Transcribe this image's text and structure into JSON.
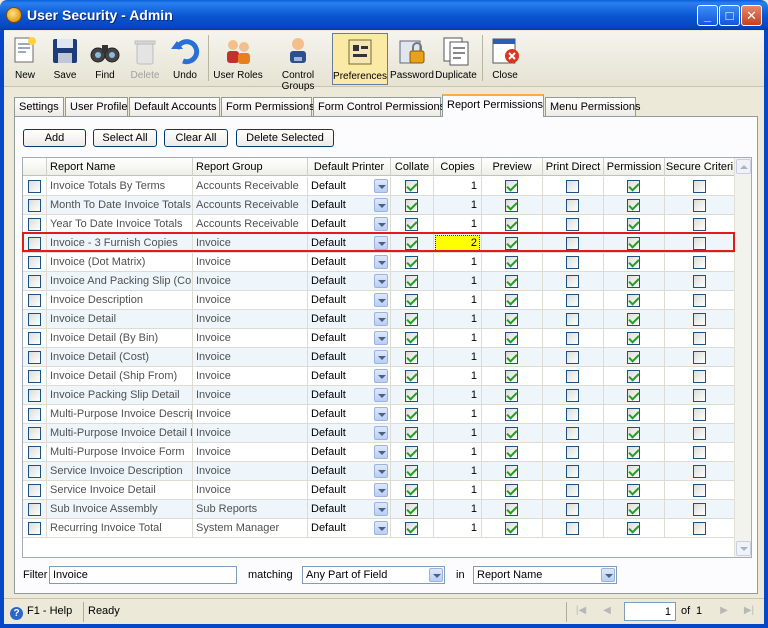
{
  "window": {
    "title": "User Security - Admin"
  },
  "toolbar": [
    {
      "label": "New",
      "icon": "new-document-icon",
      "state": "normal"
    },
    {
      "label": "Save",
      "icon": "floppy-disk-icon",
      "state": "normal"
    },
    {
      "label": "Find",
      "icon": "binoculars-icon",
      "state": "normal"
    },
    {
      "label": "Delete",
      "icon": "recycle-bin-icon",
      "state": "disabled"
    },
    {
      "label": "Undo",
      "icon": "undo-arrow-icon",
      "state": "normal"
    },
    {
      "label": "User Roles",
      "icon": "users-icon",
      "state": "normal"
    },
    {
      "label": "Control Groups",
      "icon": "user-group-icon",
      "state": "normal"
    },
    {
      "label": "Preferences",
      "icon": "preferences-icon",
      "state": "active"
    },
    {
      "label": "Password",
      "icon": "password-lock-icon",
      "state": "normal"
    },
    {
      "label": "Duplicate",
      "icon": "duplicate-icon",
      "state": "normal"
    },
    {
      "label": "Close",
      "icon": "close-window-icon",
      "state": "normal"
    }
  ],
  "tabs": [
    {
      "label": "Settings",
      "active": false
    },
    {
      "label": "User Profile",
      "active": false
    },
    {
      "label": "Default Accounts",
      "active": false
    },
    {
      "label": "Form Permissions",
      "active": false
    },
    {
      "label": "Form Control Permissions",
      "active": false
    },
    {
      "label": "Report Permissions",
      "active": true
    },
    {
      "label": "Menu Permissions",
      "active": false
    }
  ],
  "actions": {
    "add": "Add",
    "select_all": "Select All",
    "clear_all": "Clear All",
    "delete_selected": "Delete Selected"
  },
  "grid": {
    "columns": [
      "",
      "Report Name",
      "Report Group",
      "Default Printer",
      "Collate",
      "Copies",
      "Preview",
      "Print Direct",
      "Permission",
      "Secure Criteri"
    ],
    "rows": [
      {
        "name": "Invoice Totals By Terms",
        "group": "Accounts Receivable",
        "printer": "Default",
        "copies": "1",
        "selected": false
      },
      {
        "name": "Month To Date Invoice Totals",
        "group": "Accounts Receivable",
        "printer": "Default",
        "copies": "1",
        "selected": false
      },
      {
        "name": "Year To Date Invoice Totals",
        "group": "Accounts Receivable",
        "printer": "Default",
        "copies": "1",
        "selected": false
      },
      {
        "name": "Invoice - 3 Furnish Copies",
        "group": "Invoice",
        "printer": "Default",
        "copies": "2",
        "selected": true
      },
      {
        "name": "Invoice (Dot Matrix)",
        "group": "Invoice",
        "printer": "Default",
        "copies": "1",
        "selected": false
      },
      {
        "name": "Invoice And Packing Slip (Com",
        "group": "Invoice",
        "printer": "Default",
        "copies": "1",
        "selected": false
      },
      {
        "name": "Invoice Description",
        "group": "Invoice",
        "printer": "Default",
        "copies": "1",
        "selected": false
      },
      {
        "name": "Invoice Detail",
        "group": "Invoice",
        "printer": "Default",
        "copies": "1",
        "selected": false
      },
      {
        "name": "Invoice Detail (By Bin)",
        "group": "Invoice",
        "printer": "Default",
        "copies": "1",
        "selected": false
      },
      {
        "name": "Invoice Detail (Cost)",
        "group": "Invoice",
        "printer": "Default",
        "copies": "1",
        "selected": false
      },
      {
        "name": "Invoice Detail (Ship From)",
        "group": "Invoice",
        "printer": "Default",
        "copies": "1",
        "selected": false
      },
      {
        "name": "Invoice Packing Slip Detail",
        "group": "Invoice",
        "printer": "Default",
        "copies": "1",
        "selected": false
      },
      {
        "name": "Multi-Purpose Invoice Descrip",
        "group": "Invoice",
        "printer": "Default",
        "copies": "1",
        "selected": false
      },
      {
        "name": "Multi-Purpose Invoice Detail F",
        "group": "Invoice",
        "printer": "Default",
        "copies": "1",
        "selected": false
      },
      {
        "name": "Multi-Purpose Invoice Form",
        "group": "Invoice",
        "printer": "Default",
        "copies": "1",
        "selected": false
      },
      {
        "name": "Service Invoice Description",
        "group": "Invoice",
        "printer": "Default",
        "copies": "1",
        "selected": false
      },
      {
        "name": "Service Invoice Detail",
        "group": "Invoice",
        "printer": "Default",
        "copies": "1",
        "selected": false
      },
      {
        "name": "Sub Invoice Assembly",
        "group": "Sub Reports",
        "printer": "Default",
        "copies": "1",
        "selected": false
      },
      {
        "name": "Recurring Invoice Total",
        "group": "System Manager",
        "printer": "Default",
        "copies": "1",
        "selected": false
      }
    ]
  },
  "filter": {
    "label": "Filter",
    "value": "Invoice",
    "matching_label": "matching",
    "matching_value": "Any Part of Field",
    "in_label": "in",
    "in_value": "Report Name"
  },
  "status": {
    "help": "F1 - Help",
    "state": "Ready",
    "page": "1",
    "of_label": "of",
    "total_pages": "1"
  },
  "colors": {
    "titlebar": "#0b58d3",
    "highlight_row_border": "#e31a1a",
    "copies_highlight": "#ffff00",
    "check": "#21a121"
  }
}
